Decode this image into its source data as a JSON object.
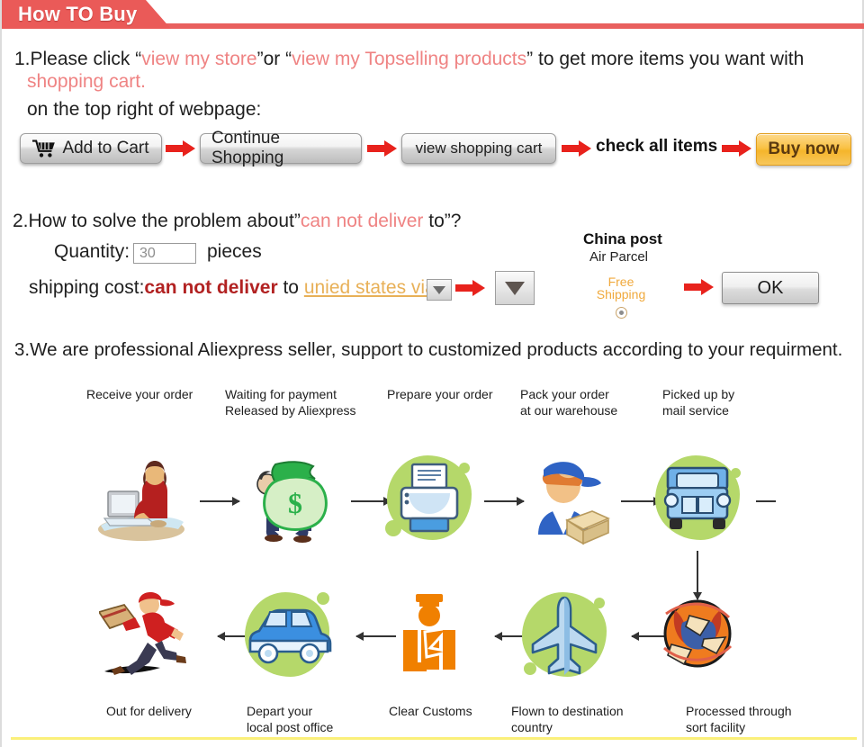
{
  "header": {
    "title": "How TO Buy"
  },
  "step1": {
    "line1_a": "1.Please click “",
    "line1_link1": "view my store",
    "line1_b": "”or “",
    "line1_link2": "view my Topselling products",
    "line1_c": "” to get more items you want with",
    "line2_link": "shopping cart",
    "line2_after": ".",
    "line3": "on the top right of webpage:",
    "buttons": {
      "add_to_cart": "Add to Cart",
      "continue_shopping": "Continue Shopping",
      "view_shopping_cart": "view shopping cart",
      "check_all_items": "check all items",
      "buy_now": "Buy now"
    },
    "icons": {
      "cart": "shopping-cart-icon",
      "arrow": "red-arrow-icon"
    }
  },
  "step2": {
    "heading_a": "2.How to solve the problem about”",
    "heading_red": "can not deliver",
    "heading_b": " to”?",
    "quantity_label": "Quantity:",
    "quantity_value": "30",
    "pieces_label": "pieces",
    "shipping_label": "shipping cost:",
    "shipping_red": "can not deliver",
    "shipping_to": " to ",
    "country_link": "unied states via",
    "carrier_title": "China post",
    "carrier_sub": "Air Parcel",
    "free_line1": "Free",
    "free_line2": "Shipping",
    "ok_label": "OK",
    "icons": {
      "dropdown": "chevron-down-icon",
      "radio": "radio-selected-icon"
    }
  },
  "step3": {
    "heading": "3.We are professional Aliexpress seller, support to customized products according to your requirment.",
    "row1_labels": [
      {
        "l1": "Receive your order",
        "l2": ""
      },
      {
        "l1": "Waiting for payment",
        "l2": "Released by Aliexpress"
      },
      {
        "l1": "Prepare your order",
        "l2": ""
      },
      {
        "l1": "Pack your order",
        "l2": "at our warehouse"
      },
      {
        "l1": "Picked up by",
        "l2": "mail service"
      }
    ],
    "row2_labels": [
      {
        "l1": "Out for delivery",
        "l2": ""
      },
      {
        "l1": "Depart your",
        "l2": "local post office"
      },
      {
        "l1": "Clear Customs",
        "l2": ""
      },
      {
        "l1": "Flown to destination",
        "l2": "country"
      },
      {
        "l1": "Processed through",
        "l2": "sort facility"
      }
    ],
    "row1_icons": [
      "person-at-computer-icon",
      "money-bag-icon",
      "printer-icon",
      "warehouse-worker-icon",
      "delivery-truck-icon"
    ],
    "row2_icons": [
      "running-courier-icon",
      "delivery-van-icon",
      "customs-officer-icon",
      "airplane-icon",
      "globe-mail-icon"
    ]
  },
  "colors": {
    "banner": "#ea5a58",
    "link_red": "#ef8383",
    "dark_red": "#b22222",
    "orange": "#e8b057",
    "buy_now": "#f9c246",
    "blob_green": "#b5d86a",
    "bottom_rule": "#fbf07a"
  }
}
